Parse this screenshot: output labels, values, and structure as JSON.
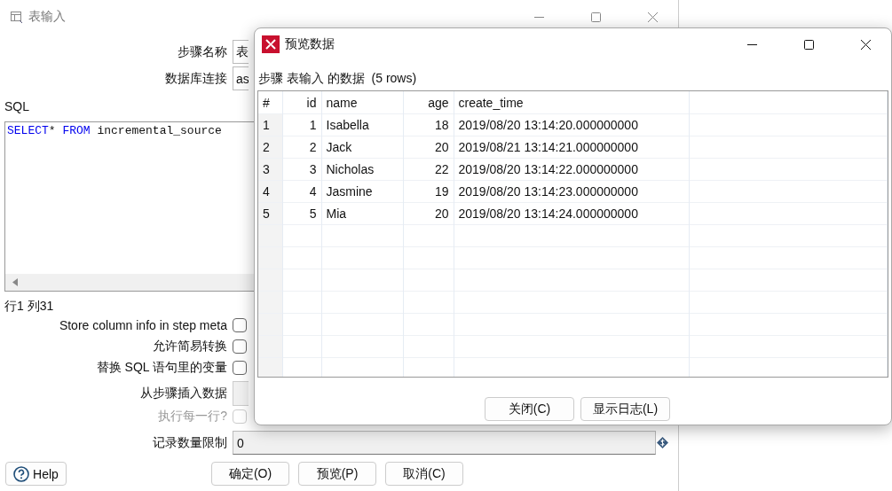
{
  "main_window": {
    "title": "表输入",
    "fields": [
      {
        "label": "步骤名称",
        "value": "表"
      },
      {
        "label": "数据库连接",
        "value": "as"
      }
    ],
    "sql_label": "SQL",
    "sql_tokens": [
      {
        "kind": "keyword",
        "text": "SELECT"
      },
      {
        "kind": "plain",
        "text": "* "
      },
      {
        "kind": "keyword",
        "text": "FROM"
      },
      {
        "kind": "plain",
        "text": " incremental_source"
      }
    ],
    "cursor_position": "行1 列31",
    "options": [
      {
        "kind": "checkbox",
        "label": "Store column info in step meta",
        "checked": false,
        "disabled": false
      },
      {
        "kind": "checkbox",
        "label": "允许简易转换",
        "checked": false,
        "disabled": false
      },
      {
        "kind": "checkbox",
        "label": "替换 SQL 语句里的变量",
        "checked": false,
        "disabled": false
      },
      {
        "kind": "dropdown",
        "label": "从步骤插入数据"
      },
      {
        "kind": "checkbox",
        "label": "执行每一行?",
        "checked": false,
        "disabled": true
      },
      {
        "kind": "field",
        "label": "记录数量限制",
        "value": "0"
      }
    ],
    "help_button": "Help",
    "buttons": [
      "确定(O)",
      "预览(P)",
      "取消(C)"
    ]
  },
  "preview_dialog": {
    "title": "预览数据",
    "caption": "步骤 表输入 的数据  (5 rows)",
    "table": {
      "columns": [
        "#",
        "id",
        "name",
        "age",
        "create_time"
      ],
      "rows": [
        [
          "1",
          "1",
          "Isabella",
          "18",
          "2019/08/20 13:14:20.000000000"
        ],
        [
          "2",
          "2",
          "Jack",
          "20",
          "2019/08/21 13:14:21.000000000"
        ],
        [
          "3",
          "3",
          "Nicholas",
          "22",
          "2019/08/20 13:14:22.000000000"
        ],
        [
          "4",
          "4",
          "Jasmine",
          "19",
          "2019/08/20 13:14:23.000000000"
        ],
        [
          "5",
          "5",
          "Mia",
          "20",
          "2019/08/20 13:14:24.000000000"
        ]
      ]
    },
    "buttons": [
      "关闭(C)",
      "显示日志(L)"
    ]
  }
}
